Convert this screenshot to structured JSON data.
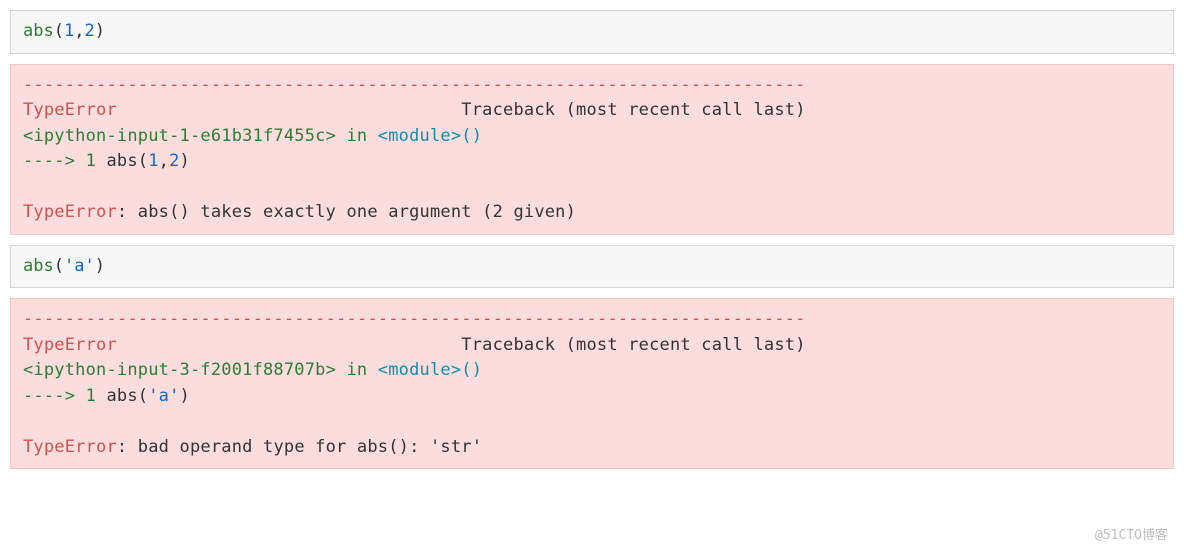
{
  "cells": [
    {
      "type": "input",
      "spans": [
        {
          "cls": "t-call",
          "t": "abs"
        },
        {
          "cls": "t-punc",
          "t": "("
        },
        {
          "cls": "t-num",
          "t": "1"
        },
        {
          "cls": "t-punc",
          "t": ","
        },
        {
          "cls": "t-num",
          "t": "2"
        },
        {
          "cls": "t-punc",
          "t": ")"
        }
      ]
    },
    {
      "type": "error",
      "spans": [
        {
          "cls": "t-dash",
          "t": "---------------------------------------------------------------------------\n"
        },
        {
          "cls": "t-err",
          "t": "TypeError"
        },
        {
          "cls": "t-plain",
          "t": "                                 Traceback (most recent call last)\n"
        },
        {
          "cls": "t-hash",
          "t": "<ipython-input-1-e61b31f7455c>"
        },
        {
          "cls": "t-plain",
          "t": " "
        },
        {
          "cls": "t-kw",
          "t": "in"
        },
        {
          "cls": "t-plain",
          "t": " "
        },
        {
          "cls": "t-mod",
          "t": "<module>"
        },
        {
          "cls": "t-mod",
          "t": "()"
        },
        {
          "cls": "t-plain",
          "t": "\n"
        },
        {
          "cls": "t-line",
          "t": "----> 1"
        },
        {
          "cls": "t-plain",
          "t": " abs"
        },
        {
          "cls": "t-punc",
          "t": "("
        },
        {
          "cls": "t-num",
          "t": "1"
        },
        {
          "cls": "t-punc",
          "t": ","
        },
        {
          "cls": "t-num",
          "t": "2"
        },
        {
          "cls": "t-punc",
          "t": ")"
        },
        {
          "cls": "t-plain",
          "t": "\n\n"
        },
        {
          "cls": "t-err",
          "t": "TypeError"
        },
        {
          "cls": "t-plain",
          "t": ": abs() takes exactly one argument (2 given)"
        }
      ]
    },
    {
      "type": "input",
      "spans": [
        {
          "cls": "t-call",
          "t": "abs"
        },
        {
          "cls": "t-punc",
          "t": "("
        },
        {
          "cls": "t-str",
          "t": "'a'"
        },
        {
          "cls": "t-punc",
          "t": ")"
        }
      ]
    },
    {
      "type": "error",
      "spans": [
        {
          "cls": "t-dash",
          "t": "---------------------------------------------------------------------------\n"
        },
        {
          "cls": "t-err",
          "t": "TypeError"
        },
        {
          "cls": "t-plain",
          "t": "                                 Traceback (most recent call last)\n"
        },
        {
          "cls": "t-hash",
          "t": "<ipython-input-3-f2001f88707b>"
        },
        {
          "cls": "t-plain",
          "t": " "
        },
        {
          "cls": "t-kw",
          "t": "in"
        },
        {
          "cls": "t-plain",
          "t": " "
        },
        {
          "cls": "t-mod",
          "t": "<module>"
        },
        {
          "cls": "t-mod",
          "t": "()"
        },
        {
          "cls": "t-plain",
          "t": "\n"
        },
        {
          "cls": "t-line",
          "t": "----> 1"
        },
        {
          "cls": "t-plain",
          "t": " abs"
        },
        {
          "cls": "t-punc",
          "t": "("
        },
        {
          "cls": "t-str",
          "t": "'a'"
        },
        {
          "cls": "t-punc",
          "t": ")"
        },
        {
          "cls": "t-plain",
          "t": "\n\n"
        },
        {
          "cls": "t-err",
          "t": "TypeError"
        },
        {
          "cls": "t-plain",
          "t": ": bad operand type for abs(): 'str'"
        }
      ]
    }
  ],
  "watermark": "@51CTO博客"
}
